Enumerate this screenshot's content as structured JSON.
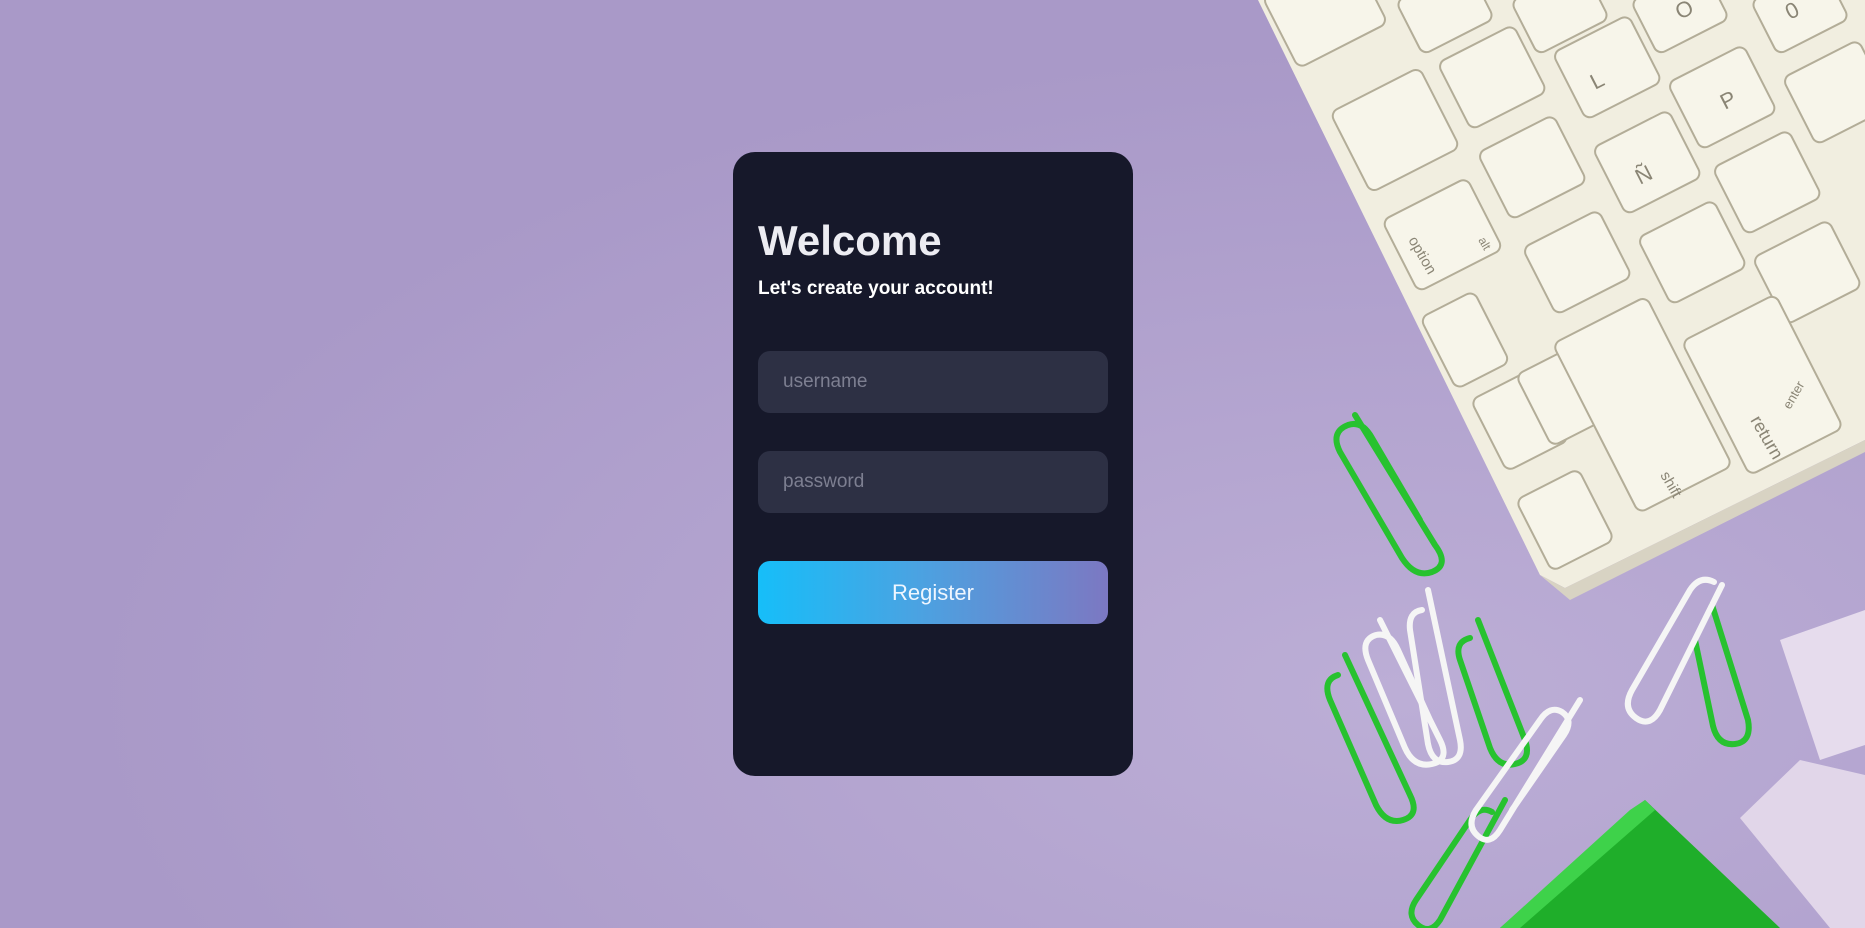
{
  "form": {
    "title": "Welcome",
    "subtitle": "Let's create your account!",
    "username_placeholder": "username",
    "password_placeholder": "password",
    "register_label": "Register"
  },
  "keyboard": {
    "key_labels": [
      "option",
      "alt",
      "shift",
      "return",
      "enter",
      "L",
      "P",
      "Ñ",
      "O",
      "0"
    ]
  },
  "colors": {
    "background": "#ac9cca",
    "card": "#16182a",
    "input": "#2d3044",
    "button_gradient_start": "#16bef9",
    "button_gradient_end": "#7c78c2"
  }
}
